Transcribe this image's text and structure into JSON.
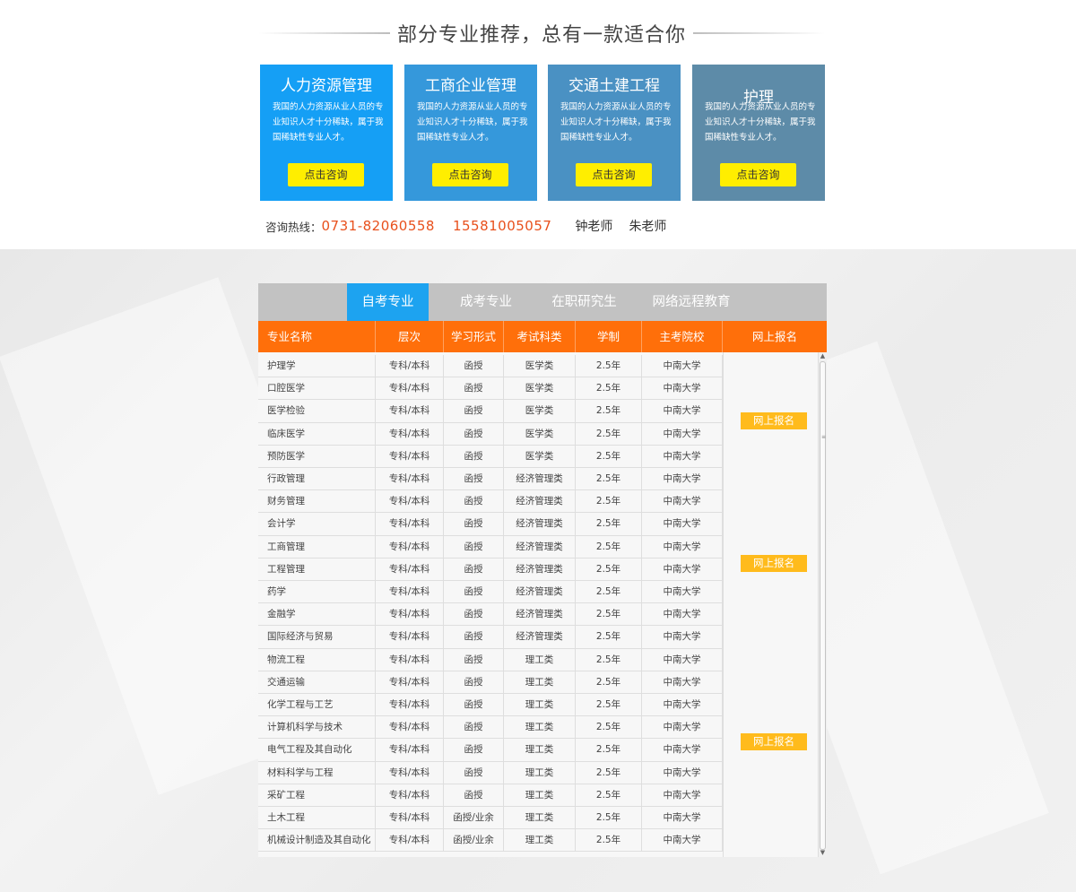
{
  "heading": "部分专业推荐，总有一款适合你",
  "cards": [
    {
      "title": "人力资源管理",
      "desc": "我国的人力资源从业人员的专业知识人才十分稀缺，属于我国稀缺性专业人才。",
      "button": "点击咨询",
      "color": "#159ff5"
    },
    {
      "title": "工商企业管理",
      "desc": "我国的人力资源从业人员的专业知识人才十分稀缺，属于我国稀缺性专业人才。",
      "button": "点击咨询",
      "color": "#3598db"
    },
    {
      "title": "交通土建工程",
      "desc": "我国的人力资源从业人员的专业知识人才十分稀缺，属于我国稀缺性专业人才。",
      "button": "点击咨询",
      "color": "#4a91c3"
    },
    {
      "title": "护理",
      "desc": "我国的人力资源从业人员的专业知识人才十分稀缺，属于我国稀缺性专业人才。",
      "button": "点击咨询",
      "color": "#5d8ba8"
    }
  ],
  "hotline": {
    "label": "咨询热线：",
    "phone1": "0731-82060558",
    "phone2": "15581005057",
    "teacher1": "钟老师",
    "teacher2": "朱老师"
  },
  "tabs": [
    "自考专业",
    "成考专业",
    "在职研究生",
    "网络远程教育"
  ],
  "active_tab": "自考专业",
  "table": {
    "headers": [
      "专业名称",
      "层次",
      "学习形式",
      "考试科类",
      "学制",
      "主考院校",
      "网上报名"
    ],
    "rows": [
      [
        "护理学",
        "专科/本科",
        "函授",
        "医学类",
        "2.5年",
        "中南大学"
      ],
      [
        "口腔医学",
        "专科/本科",
        "函授",
        "医学类",
        "2.5年",
        "中南大学"
      ],
      [
        "医学检验",
        "专科/本科",
        "函授",
        "医学类",
        "2.5年",
        "中南大学"
      ],
      [
        "临床医学",
        "专科/本科",
        "函授",
        "医学类",
        "2.5年",
        "中南大学"
      ],
      [
        "预防医学",
        "专科/本科",
        "函授",
        "医学类",
        "2.5年",
        "中南大学"
      ],
      [
        "行政管理",
        "专科/本科",
        "函授",
        "经济管理类",
        "2.5年",
        "中南大学"
      ],
      [
        "财务管理",
        "专科/本科",
        "函授",
        "经济管理类",
        "2.5年",
        "中南大学"
      ],
      [
        "会计学",
        "专科/本科",
        "函授",
        "经济管理类",
        "2.5年",
        "中南大学"
      ],
      [
        "工商管理",
        "专科/本科",
        "函授",
        "经济管理类",
        "2.5年",
        "中南大学"
      ],
      [
        "工程管理",
        "专科/本科",
        "函授",
        "经济管理类",
        "2.5年",
        "中南大学"
      ],
      [
        "药学",
        "专科/本科",
        "函授",
        "经济管理类",
        "2.5年",
        "中南大学"
      ],
      [
        "金融学",
        "专科/本科",
        "函授",
        "经济管理类",
        "2.5年",
        "中南大学"
      ],
      [
        "国际经济与贸易",
        "专科/本科",
        "函授",
        "经济管理类",
        "2.5年",
        "中南大学"
      ],
      [
        "物流工程",
        "专科/本科",
        "函授",
        "理工类",
        "2.5年",
        "中南大学"
      ],
      [
        "交通运输",
        "专科/本科",
        "函授",
        "理工类",
        "2.5年",
        "中南大学"
      ],
      [
        "化学工程与工艺",
        "专科/本科",
        "函授",
        "理工类",
        "2.5年",
        "中南大学"
      ],
      [
        "计算机科学与技术",
        "专科/本科",
        "函授",
        "理工类",
        "2.5年",
        "中南大学"
      ],
      [
        "电气工程及其自动化",
        "专科/本科",
        "函授",
        "理工类",
        "2.5年",
        "中南大学"
      ],
      [
        "材料科学与工程",
        "专科/本科",
        "函授",
        "理工类",
        "2.5年",
        "中南大学"
      ],
      [
        "采矿工程",
        "专科/本科",
        "函授",
        "理工类",
        "2.5年",
        "中南大学"
      ],
      [
        "土木工程",
        "专科/本科",
        "函授/业余",
        "理工类",
        "2.5年",
        "中南大学"
      ],
      [
        "机械设计制造及其自动化",
        "专科/本科",
        "函授/业余",
        "理工类",
        "2.5年",
        "中南大学"
      ]
    ],
    "enroll_label": "网上报名"
  }
}
